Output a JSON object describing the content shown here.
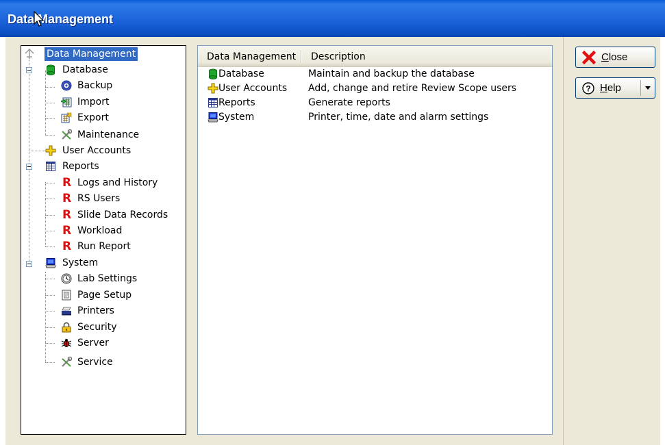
{
  "window": {
    "title": "Data Management"
  },
  "tree": {
    "root": "Data Management",
    "items": [
      {
        "label": "Database",
        "icon": "database-icon"
      },
      {
        "label": "Backup",
        "icon": "backup-icon"
      },
      {
        "label": "Import",
        "icon": "import-icon"
      },
      {
        "label": "Export",
        "icon": "export-icon"
      },
      {
        "label": "Maintenance",
        "icon": "maintenance-icon"
      },
      {
        "label": "User Accounts",
        "icon": "user-accounts-icon"
      },
      {
        "label": "Reports",
        "icon": "reports-icon"
      },
      {
        "label": "Logs and History",
        "icon": "report-r-icon"
      },
      {
        "label": "RS Users",
        "icon": "report-r-icon"
      },
      {
        "label": "Slide Data Records",
        "icon": "report-r-icon"
      },
      {
        "label": "Workload",
        "icon": "report-r-icon"
      },
      {
        "label": "Run Report",
        "icon": "report-r-icon"
      },
      {
        "label": "System",
        "icon": "system-icon"
      },
      {
        "label": "Lab Settings",
        "icon": "clock-icon"
      },
      {
        "label": "Page Setup",
        "icon": "page-setup-icon"
      },
      {
        "label": "Printers",
        "icon": "printer-icon"
      },
      {
        "label": "Security",
        "icon": "lock-icon"
      },
      {
        "label": "Server",
        "icon": "bug-icon"
      },
      {
        "label": "Service",
        "icon": "tools-icon"
      }
    ]
  },
  "list": {
    "columns": [
      "Data Management",
      "Description"
    ],
    "rows": [
      {
        "name": "Database",
        "description": "Maintain and backup the database",
        "icon": "database-icon"
      },
      {
        "name": "User Accounts",
        "description": "Add, change and retire Review Scope users",
        "icon": "user-accounts-icon"
      },
      {
        "name": "Reports",
        "description": "Generate reports",
        "icon": "reports-icon"
      },
      {
        "name": "System",
        "description": "Printer, time, date and alarm settings",
        "icon": "system-icon"
      }
    ]
  },
  "buttons": {
    "close_label_accel": "C",
    "close_label_rest": "lose",
    "help_label_accel": "H",
    "help_label_rest": "elp"
  },
  "colors": {
    "titlebar": "#0a5bd8",
    "selection": "#316ac5",
    "dialog_bg": "#ece9d8"
  }
}
